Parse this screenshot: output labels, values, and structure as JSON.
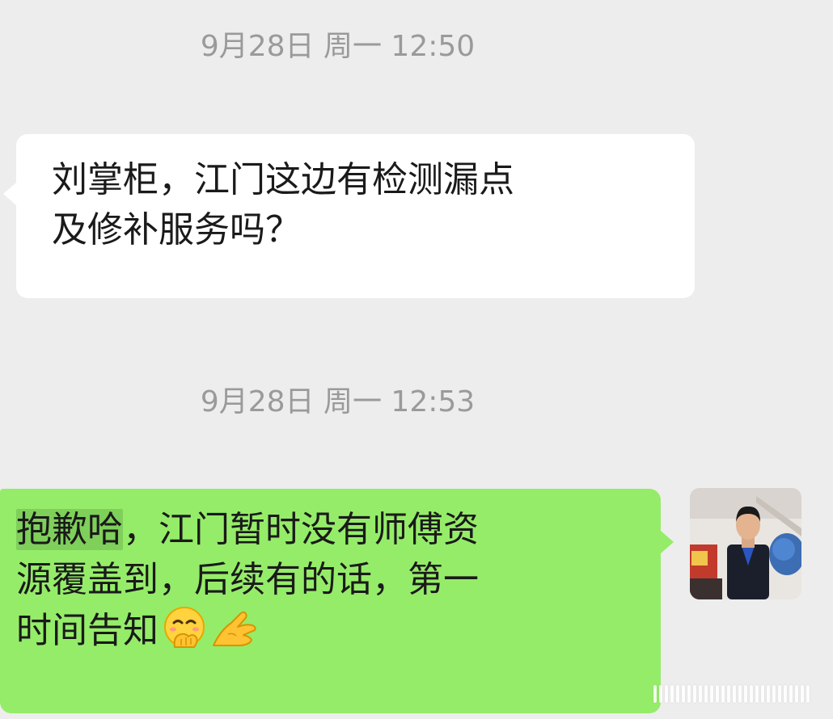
{
  "messages": [
    {
      "timestamp": "9月28日 周一 12:50",
      "direction": "incoming",
      "line1": "刘掌柜，江门这边有检测漏点",
      "line2": "及修补服务吗？"
    },
    {
      "timestamp": "9月28日 周一 12:53",
      "direction": "outgoing",
      "highlight": "抱歉哈",
      "line1_rest": "，江门暂时没有师傅资",
      "line2": "源覆盖到，后续有的话，第一",
      "line3": "时间告知",
      "emojis": [
        "face-with-hand-over-mouth-icon",
        "pinching-hand-icon"
      ]
    }
  ],
  "colors": {
    "background": "#ededed",
    "incoming_bubble": "#ffffff",
    "outgoing_bubble": "#95ec69",
    "highlight": "#7fcf5b",
    "timestamp_text": "#9a9a9a"
  }
}
